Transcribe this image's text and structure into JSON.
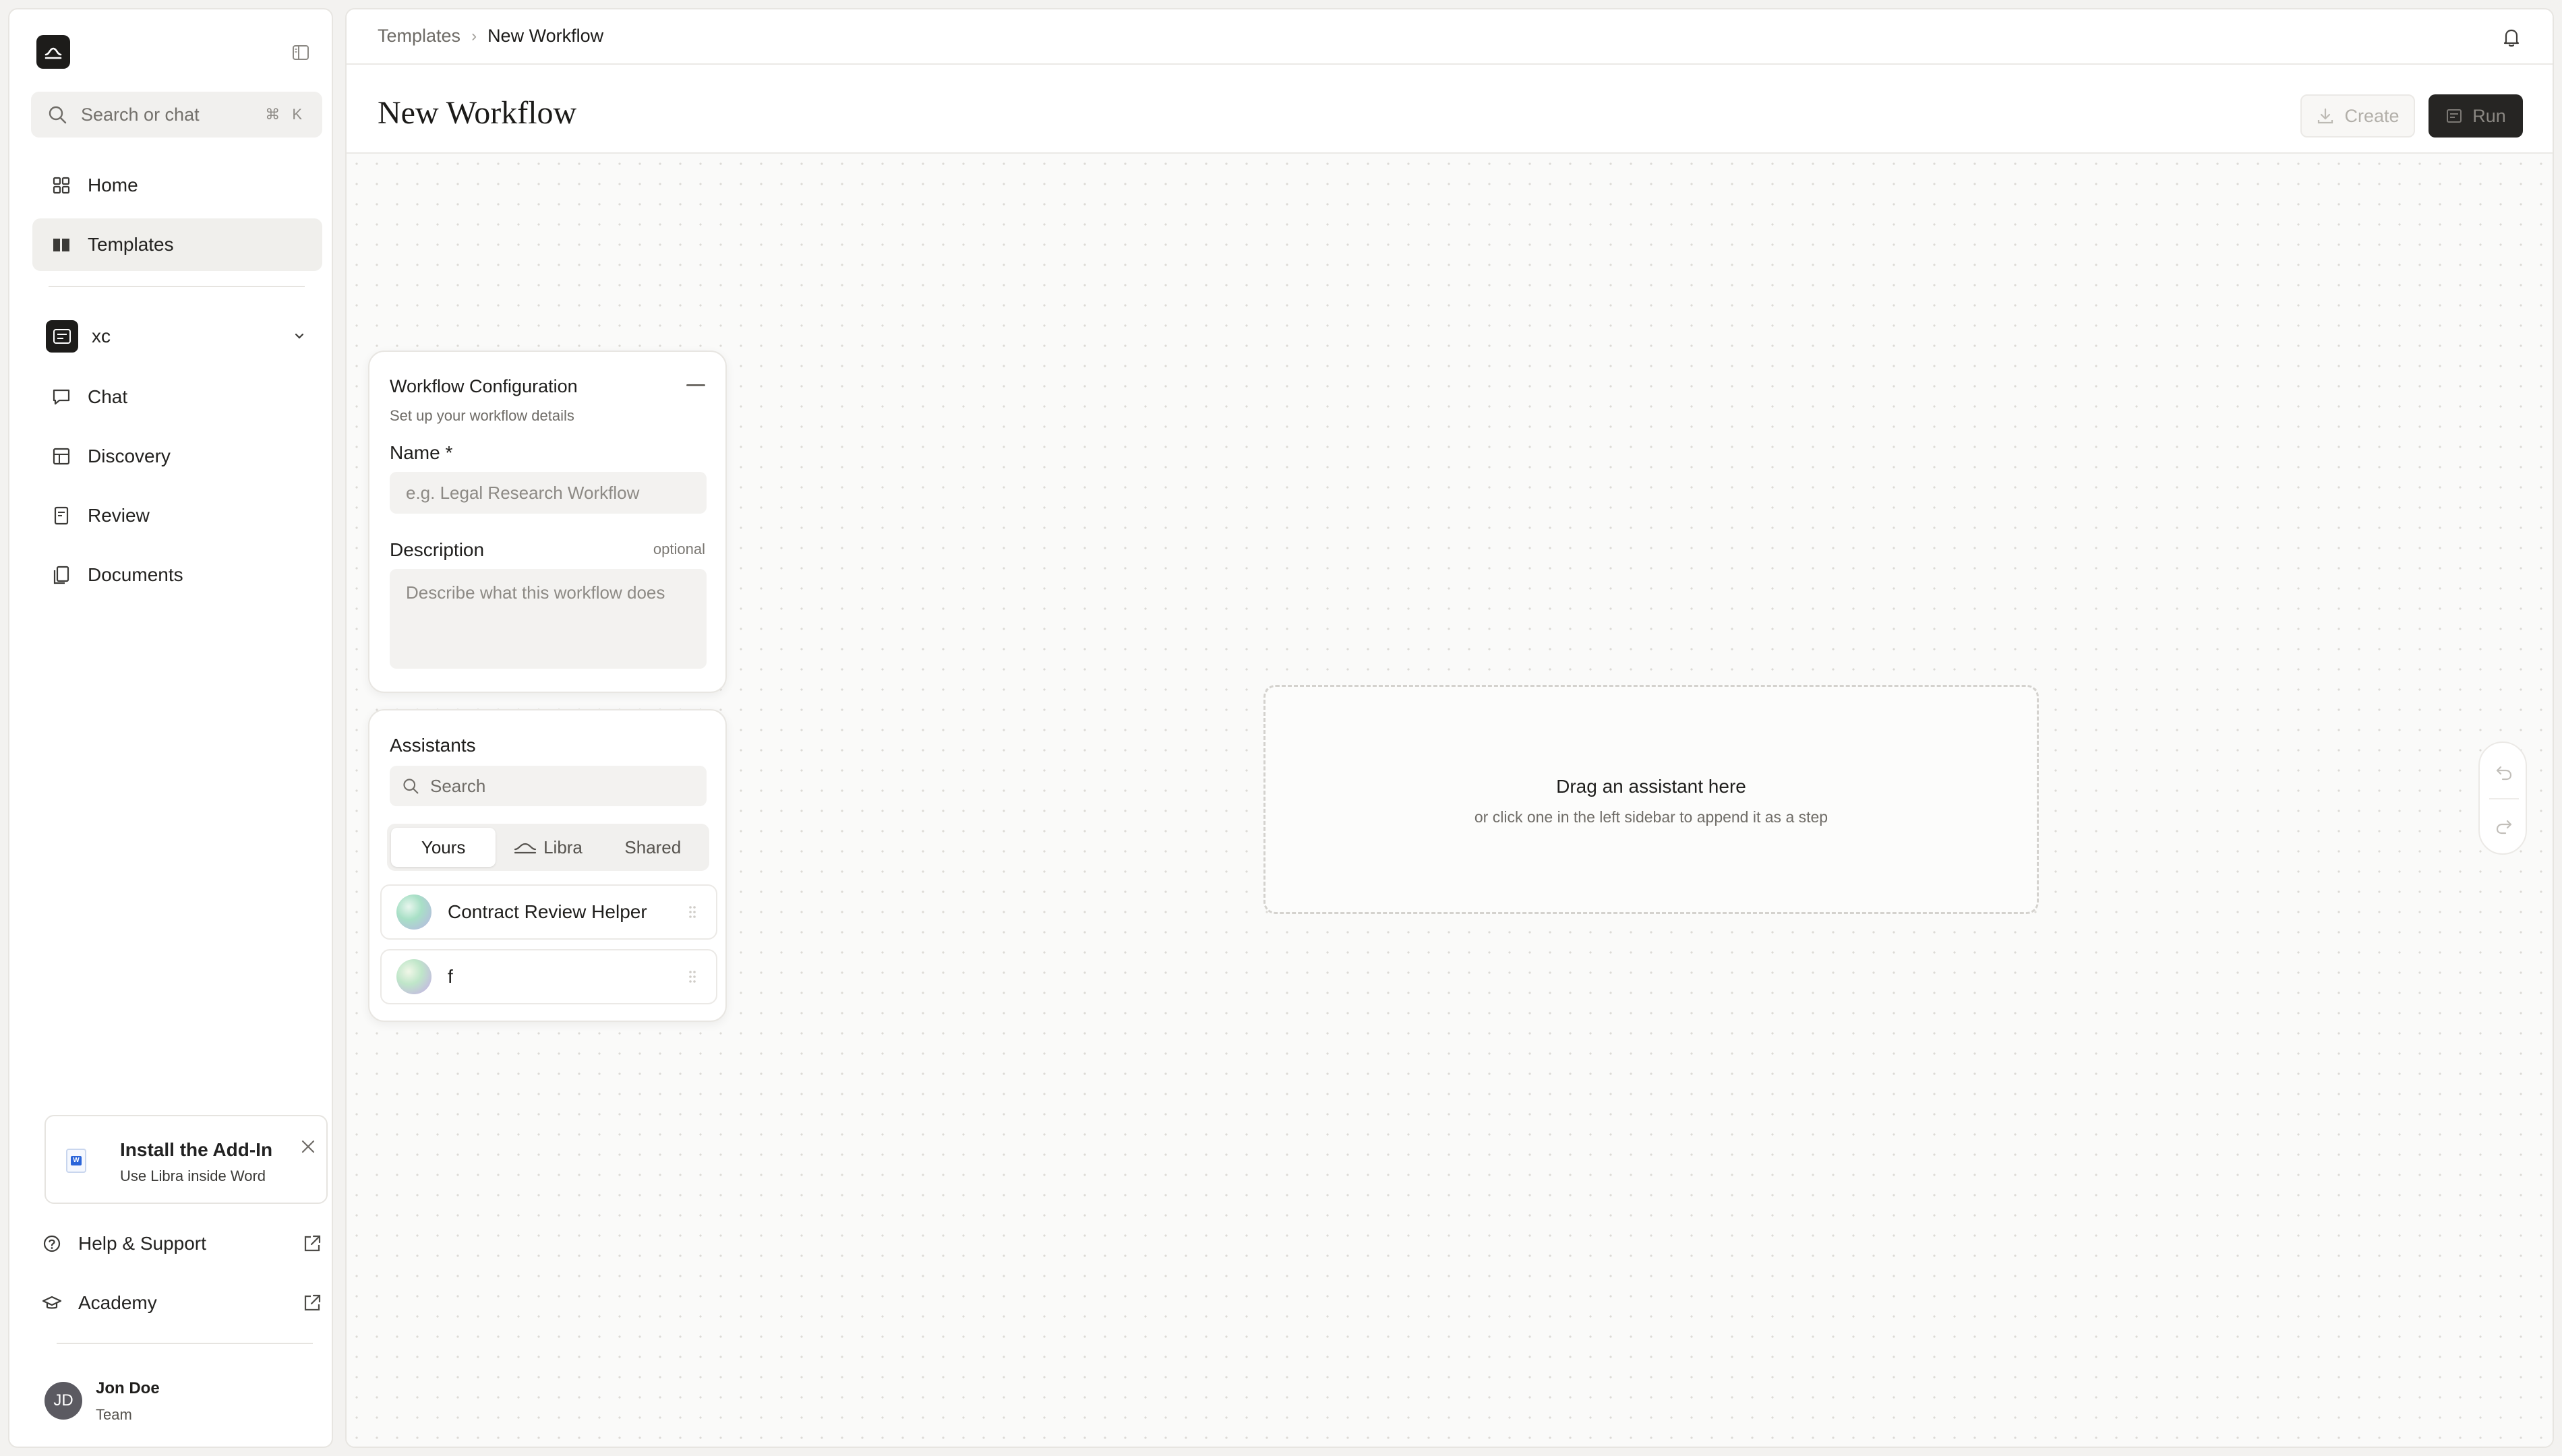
{
  "sidebar": {
    "search": {
      "label": "Search or chat",
      "shortcut": "⌘ K"
    },
    "nav": [
      {
        "label": "Home",
        "icon": "home-grid-icon"
      },
      {
        "label": "Templates",
        "icon": "book-icon",
        "active": true
      }
    ],
    "workspace": {
      "name": "xc",
      "items": [
        {
          "label": "Chat",
          "icon": "chat-icon"
        },
        {
          "label": "Discovery",
          "icon": "table-icon"
        },
        {
          "label": "Review",
          "icon": "review-doc-icon"
        },
        {
          "label": "Documents",
          "icon": "documents-icon"
        }
      ]
    },
    "addin": {
      "title": "Install the Add-In",
      "subtitle": "Use Libra inside Word"
    },
    "footer": [
      {
        "label": "Help & Support",
        "icon": "help-circle-icon"
      },
      {
        "label": "Academy",
        "icon": "graduation-cap-icon"
      }
    ],
    "user": {
      "initials": "JD",
      "name": "Jon Doe",
      "role": "Team"
    }
  },
  "topbar": {
    "breadcrumb": {
      "parent": "Templates",
      "separator": "›",
      "current": "New Workflow"
    }
  },
  "header": {
    "title": "New Workflow",
    "create_label": "Create",
    "run_label": "Run"
  },
  "config": {
    "title": "Workflow Configuration",
    "subtitle": "Set up your workflow details",
    "name_label": "Name *",
    "name_placeholder": "e.g. Legal Research Workflow",
    "description_label": "Description",
    "optional_label": "optional",
    "description_placeholder": "Describe what this workflow does"
  },
  "assistants": {
    "title": "Assistants",
    "search_placeholder": "Search",
    "tabs": [
      {
        "label": "Yours",
        "active": true
      },
      {
        "label": "Libra",
        "active": false
      },
      {
        "label": "Shared",
        "active": false
      }
    ],
    "items": [
      {
        "name": "Contract Review Helper"
      },
      {
        "name": "f"
      }
    ]
  },
  "canvas": {
    "drop_title": "Drag an assistant here",
    "drop_subtitle": "or click one in the left sidebar to append it as a step"
  },
  "colors": {
    "accent_dark": "#1d1c1a",
    "sidebar_active": "#f0efec",
    "canvas_bg": "#fafaf9"
  }
}
